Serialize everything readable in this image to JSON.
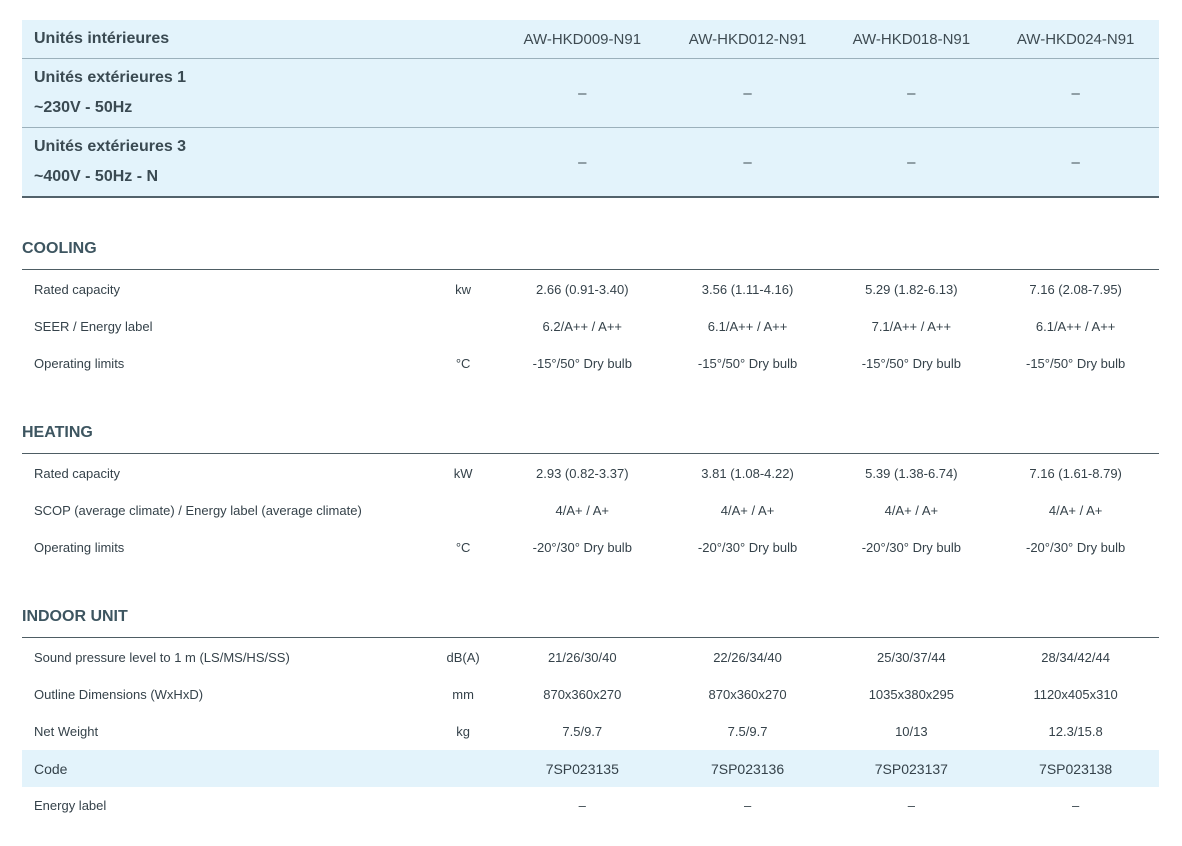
{
  "header": {
    "title": "Unités intérieures",
    "models": [
      "AW-HKD009-N91",
      "AW-HKD012-N91",
      "AW-HKD018-N91",
      "AW-HKD024-N91"
    ],
    "outdoor1": {
      "line1": "Unités extérieures 1",
      "line2": "~230V - 50Hz",
      "values": [
        "–",
        "–",
        "–",
        "–"
      ]
    },
    "outdoor3": {
      "line1": "Unités extérieures 3",
      "line2": "~400V - 50Hz - N",
      "values": [
        "–",
        "–",
        "–",
        "–"
      ]
    }
  },
  "cooling": {
    "title": "COOLING",
    "rows": [
      {
        "label": "Rated capacity",
        "unit": "kw",
        "values": [
          "2.66 (0.91-3.40)",
          "3.56 (1.11-4.16)",
          "5.29 (1.82-6.13)",
          "7.16 (2.08-7.95)"
        ]
      },
      {
        "label": "SEER / Energy label",
        "unit": "",
        "values": [
          "6.2/A++ / A++",
          "6.1/A++ / A++",
          "7.1/A++ / A++",
          "6.1/A++ / A++"
        ]
      },
      {
        "label": "Operating limits",
        "unit": "°C",
        "values": [
          "-15°/50° Dry bulb",
          "-15°/50° Dry bulb",
          "-15°/50° Dry bulb",
          "-15°/50° Dry bulb"
        ]
      }
    ]
  },
  "heating": {
    "title": "HEATING",
    "rows": [
      {
        "label": "Rated capacity",
        "unit": "kW",
        "values": [
          "2.93 (0.82-3.37)",
          "3.81 (1.08-4.22)",
          "5.39 (1.38-6.74)",
          "7.16 (1.61-8.79)"
        ]
      },
      {
        "label": "SCOP (average climate) / Energy label (average climate)",
        "unit": "",
        "values": [
          "4/A+ / A+",
          "4/A+ / A+",
          "4/A+ / A+",
          "4/A+ / A+"
        ]
      },
      {
        "label": "Operating limits",
        "unit": "°C",
        "values": [
          "-20°/30° Dry bulb",
          "-20°/30° Dry bulb",
          "-20°/30° Dry bulb",
          "-20°/30° Dry bulb"
        ]
      }
    ]
  },
  "indoor": {
    "title": "INDOOR UNIT",
    "rows": [
      {
        "label": "Sound pressure level to 1 m (LS/MS/HS/SS)",
        "unit": "dB(A)",
        "values": [
          "21/26/30/40",
          "22/26/34/40",
          "25/30/37/44",
          "28/34/42/44"
        ]
      },
      {
        "label": "Outline Dimensions (WxHxD)",
        "unit": "mm",
        "values": [
          "870x360x270",
          "870x360x270",
          "1035x380x295",
          "1120x405x310"
        ]
      },
      {
        "label": "Net Weight",
        "unit": "kg",
        "values": [
          "7.5/9.7",
          "7.5/9.7",
          "10/13",
          "12.3/15.8"
        ]
      },
      {
        "label": "Code",
        "unit": "",
        "values": [
          "7SP023135",
          "7SP023136",
          "7SP023137",
          "7SP023138"
        ]
      },
      {
        "label": "Energy label",
        "unit": "",
        "values": [
          "–",
          "–",
          "–",
          "–"
        ]
      }
    ]
  }
}
